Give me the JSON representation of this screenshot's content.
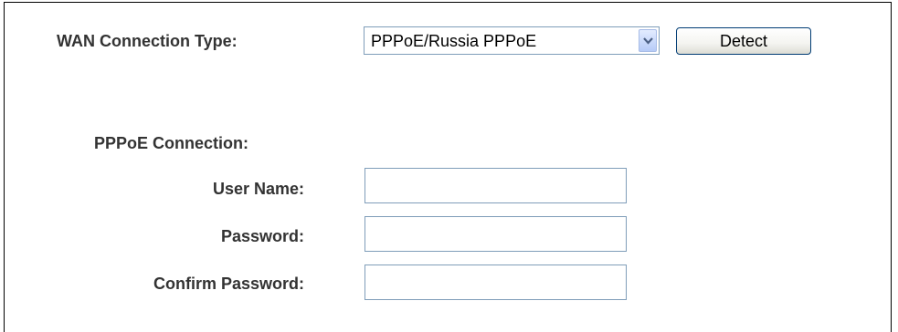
{
  "wan": {
    "label": "WAN Connection Type:",
    "selected_value": "PPPoE/Russia PPPoE",
    "detect_label": "Detect"
  },
  "pppoe": {
    "section_label": "PPPoE Connection:",
    "user_name_label": "User Name:",
    "user_name_value": "",
    "password_label": "Password:",
    "password_value": "",
    "confirm_password_label": "Confirm Password:",
    "confirm_password_value": ""
  },
  "colors": {
    "label_text": "#333333",
    "input_border": "#7f9db9",
    "button_border": "#003c74",
    "panel_border": "#000000"
  },
  "icons": {
    "dropdown": "chevron-down-icon"
  }
}
